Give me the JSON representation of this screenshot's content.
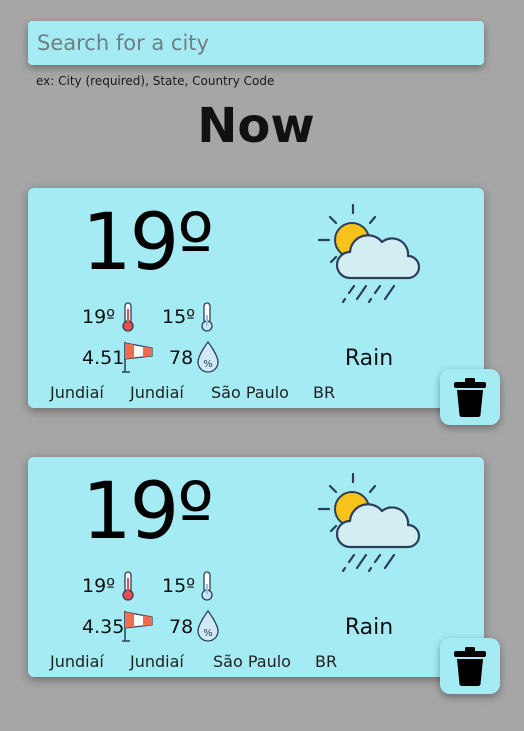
{
  "search": {
    "placeholder": "Search for a city",
    "value": "",
    "hint": "ex: City (required), State, Country Code"
  },
  "header": {
    "title": "Now"
  },
  "cards": [
    {
      "temp": "19º",
      "temp_max": "19º",
      "temp_min": "15º",
      "wind": "4.51",
      "humidity": "78",
      "condition": "Rain",
      "icon": "partly-cloudy-rain-icon",
      "city": "Jundiaí",
      "district": "Jundiaí",
      "state": "São Paulo",
      "country": "BR"
    },
    {
      "temp": "19º",
      "temp_max": "19º",
      "temp_min": "15º",
      "wind": "4.35",
      "humidity": "78",
      "condition": "Rain",
      "icon": "partly-cloudy-rain-icon",
      "city": "Jundiaí",
      "district": "Jundiaí",
      "state": "São Paulo",
      "country": "BR"
    }
  ],
  "colors": {
    "background": "#a6a6a6",
    "card": "#a5ebf3",
    "sun": "#f7c21a",
    "cloud_outline": "#2c3e5c"
  }
}
